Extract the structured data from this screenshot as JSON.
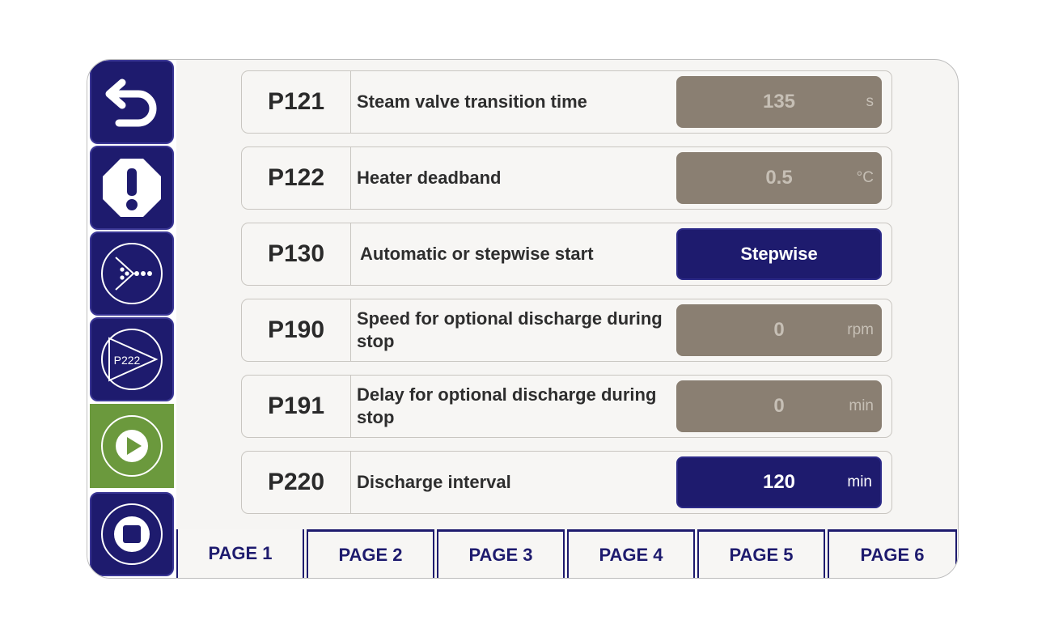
{
  "sidebar": {
    "buttons": [
      {
        "name": "back",
        "icon": "back-arrow-icon"
      },
      {
        "name": "alarm",
        "icon": "alarm-octagon-icon"
      },
      {
        "name": "discharge",
        "icon": "discharge-icon"
      },
      {
        "name": "partial-discharge",
        "icon": "discharge-p222-icon",
        "label": "P222"
      },
      {
        "name": "start",
        "icon": "play-icon"
      },
      {
        "name": "stop",
        "icon": "stop-icon"
      }
    ]
  },
  "params": [
    {
      "code": "P121",
      "label": "Steam valve transition time",
      "value": "135",
      "unit": "s",
      "editable": false
    },
    {
      "code": "P122",
      "label": "Heater deadband",
      "value": "0.5",
      "unit": "°C",
      "editable": false
    },
    {
      "code": "P130",
      "label": "Automatic or stepwise start",
      "value": "Stepwise",
      "unit": "",
      "editable": true
    },
    {
      "code": "P190",
      "label": "Speed for optional discharge during stop",
      "value": "0",
      "unit": "rpm",
      "editable": false
    },
    {
      "code": "P191",
      "label": "Delay for optional discharge during stop",
      "value": "0",
      "unit": "min",
      "editable": false
    },
    {
      "code": "P220",
      "label": "Discharge interval",
      "value": "120",
      "unit": "min",
      "editable": true
    }
  ],
  "tabs": [
    "PAGE 1",
    "PAGE 2",
    "PAGE 3",
    "PAGE 4",
    "PAGE 5",
    "PAGE 6"
  ],
  "selected_tab": "PAGE 1",
  "colors": {
    "primary": "#1e1b6e",
    "readonly_field": "#8a7f72",
    "start_green": "#6b993d",
    "panel": "#f6f5f3"
  }
}
